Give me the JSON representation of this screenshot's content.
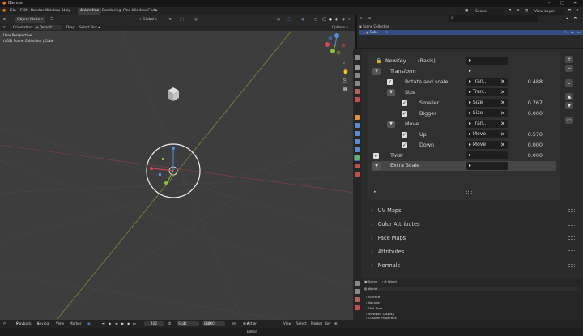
{
  "app": {
    "title": "Blender"
  },
  "menu": {
    "items": [
      "File",
      "Edit",
      "Render",
      "Window",
      "Help"
    ]
  },
  "workspaces": {
    "tabs": [
      "Animation",
      "Rendering",
      "One Window Code"
    ],
    "add": "+"
  },
  "header": {
    "scene": "Scene",
    "view_layer": "View Layer"
  },
  "viewport": {
    "mode": "Object Mode",
    "orientation_label": "Orientation:",
    "orientation_value": "Default",
    "drag_label": "Drag:",
    "select_box": "Select Box",
    "transform_orientation": "Global",
    "options": "Options",
    "view_name": "User Perspective",
    "collection_info": "(402) Scene Collection | Cube"
  },
  "outliner": {
    "scene_collection": "Scene Collection",
    "cube": "Cube"
  },
  "shape_keys": {
    "new_key": "NewKey",
    "basis": "(Basis)",
    "rows": [
      {
        "label": "Transform",
        "driver": "",
        "value": ""
      },
      {
        "label": "Rotate and scale",
        "driver": "Tran...",
        "value": "0.488"
      },
      {
        "label": "Size",
        "driver": "Tran...",
        "value": ""
      },
      {
        "label": "Smaller",
        "driver": "Size",
        "value": "0.767"
      },
      {
        "label": "Bigger",
        "driver": "Size",
        "value": "0.000"
      },
      {
        "label": "Move",
        "driver": "Tran...",
        "value": ""
      },
      {
        "label": "Up",
        "driver": "Move",
        "value": "0.570"
      },
      {
        "label": "Down",
        "driver": "Move",
        "value": "0.000"
      },
      {
        "label": "Twist",
        "driver": "",
        "value": "0.000"
      },
      {
        "label": "Extra Scale",
        "driver": "",
        "value": ""
      }
    ]
  },
  "sections": [
    "UV Maps",
    "Color Attributes",
    "Face Maps",
    "Attributes",
    "Normals"
  ],
  "action_editor": {
    "breadcrumb_scene": "Scene",
    "breadcrumb_world": "World",
    "label": "World",
    "items": [
      "Surface",
      "Volume",
      "Mist Pass",
      "Viewport Display",
      "Custom Properties"
    ]
  },
  "timeline": {
    "playback": "Playback",
    "keying": "Keying",
    "view": "View",
    "marker": "Marker",
    "current_frame": "402",
    "start_label": "Start",
    "start_value": "1",
    "end_label": "End",
    "end_value": "1000",
    "editor": "Action Editor",
    "view2": "View",
    "select": "Select",
    "marker2": "Marker",
    "key": "Key"
  },
  "colors": {
    "accent": "#4772b3",
    "panel": "#303030",
    "background": "#2b2b2b"
  }
}
